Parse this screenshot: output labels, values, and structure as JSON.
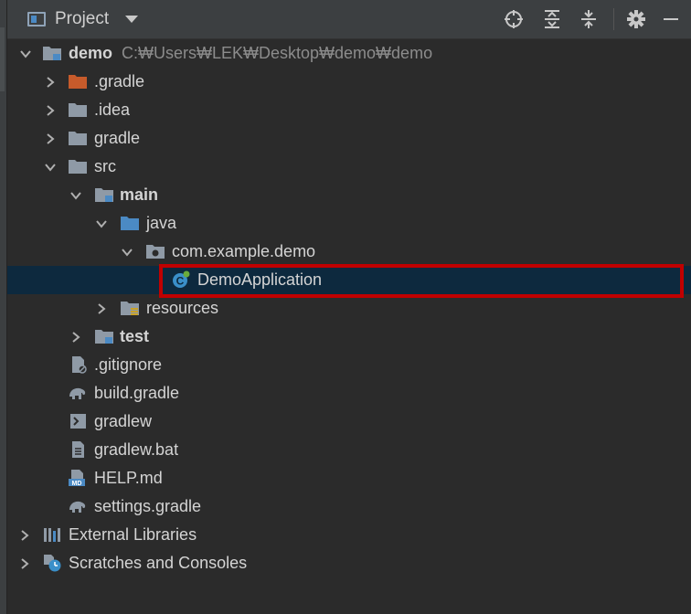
{
  "panel": {
    "title": "Project",
    "toolbar_icons": [
      "locate-icon",
      "expand-all-icon",
      "collapse-all-icon",
      "gear-icon",
      "minimize-icon"
    ]
  },
  "tree": {
    "root": {
      "label": "demo",
      "path": "C:₩Users₩LEK₩Desktop₩demo₩demo"
    },
    "items": [
      {
        "label": ".gradle",
        "icon": "orange-folder-icon"
      },
      {
        "label": ".idea",
        "icon": "folder-icon"
      },
      {
        "label": "gradle",
        "icon": "folder-icon"
      },
      {
        "label": "src",
        "icon": "folder-icon"
      },
      {
        "label": "main",
        "icon": "module-folder-icon"
      },
      {
        "label": "java",
        "icon": "source-folder-icon"
      },
      {
        "label": "com.example.demo",
        "icon": "package-icon"
      },
      {
        "label": "DemoApplication",
        "icon": "spring-class-icon"
      },
      {
        "label": "resources",
        "icon": "resources-folder-icon"
      },
      {
        "label": "test",
        "icon": "module-folder-icon"
      },
      {
        "label": ".gitignore",
        "icon": "gitignore-file-icon"
      },
      {
        "label": "build.gradle",
        "icon": "gradle-elephant-icon"
      },
      {
        "label": "gradlew",
        "icon": "shell-script-icon"
      },
      {
        "label": "gradlew.bat",
        "icon": "text-file-icon"
      },
      {
        "label": "HELP.md",
        "icon": "markdown-file-icon"
      },
      {
        "label": "settings.gradle",
        "icon": "gradle-elephant-icon"
      },
      {
        "label": "External Libraries",
        "icon": "libraries-icon"
      },
      {
        "label": "Scratches and Consoles",
        "icon": "scratches-icon"
      }
    ]
  },
  "colors": {
    "background": "#2b2b2b",
    "toolbar": "#3c3f41",
    "selection": "#0d293e",
    "highlight_box": "#c00000",
    "folder": "#8f9aa6",
    "orange_folder": "#c75b2b",
    "blue_folder": "#4b8ac4"
  }
}
